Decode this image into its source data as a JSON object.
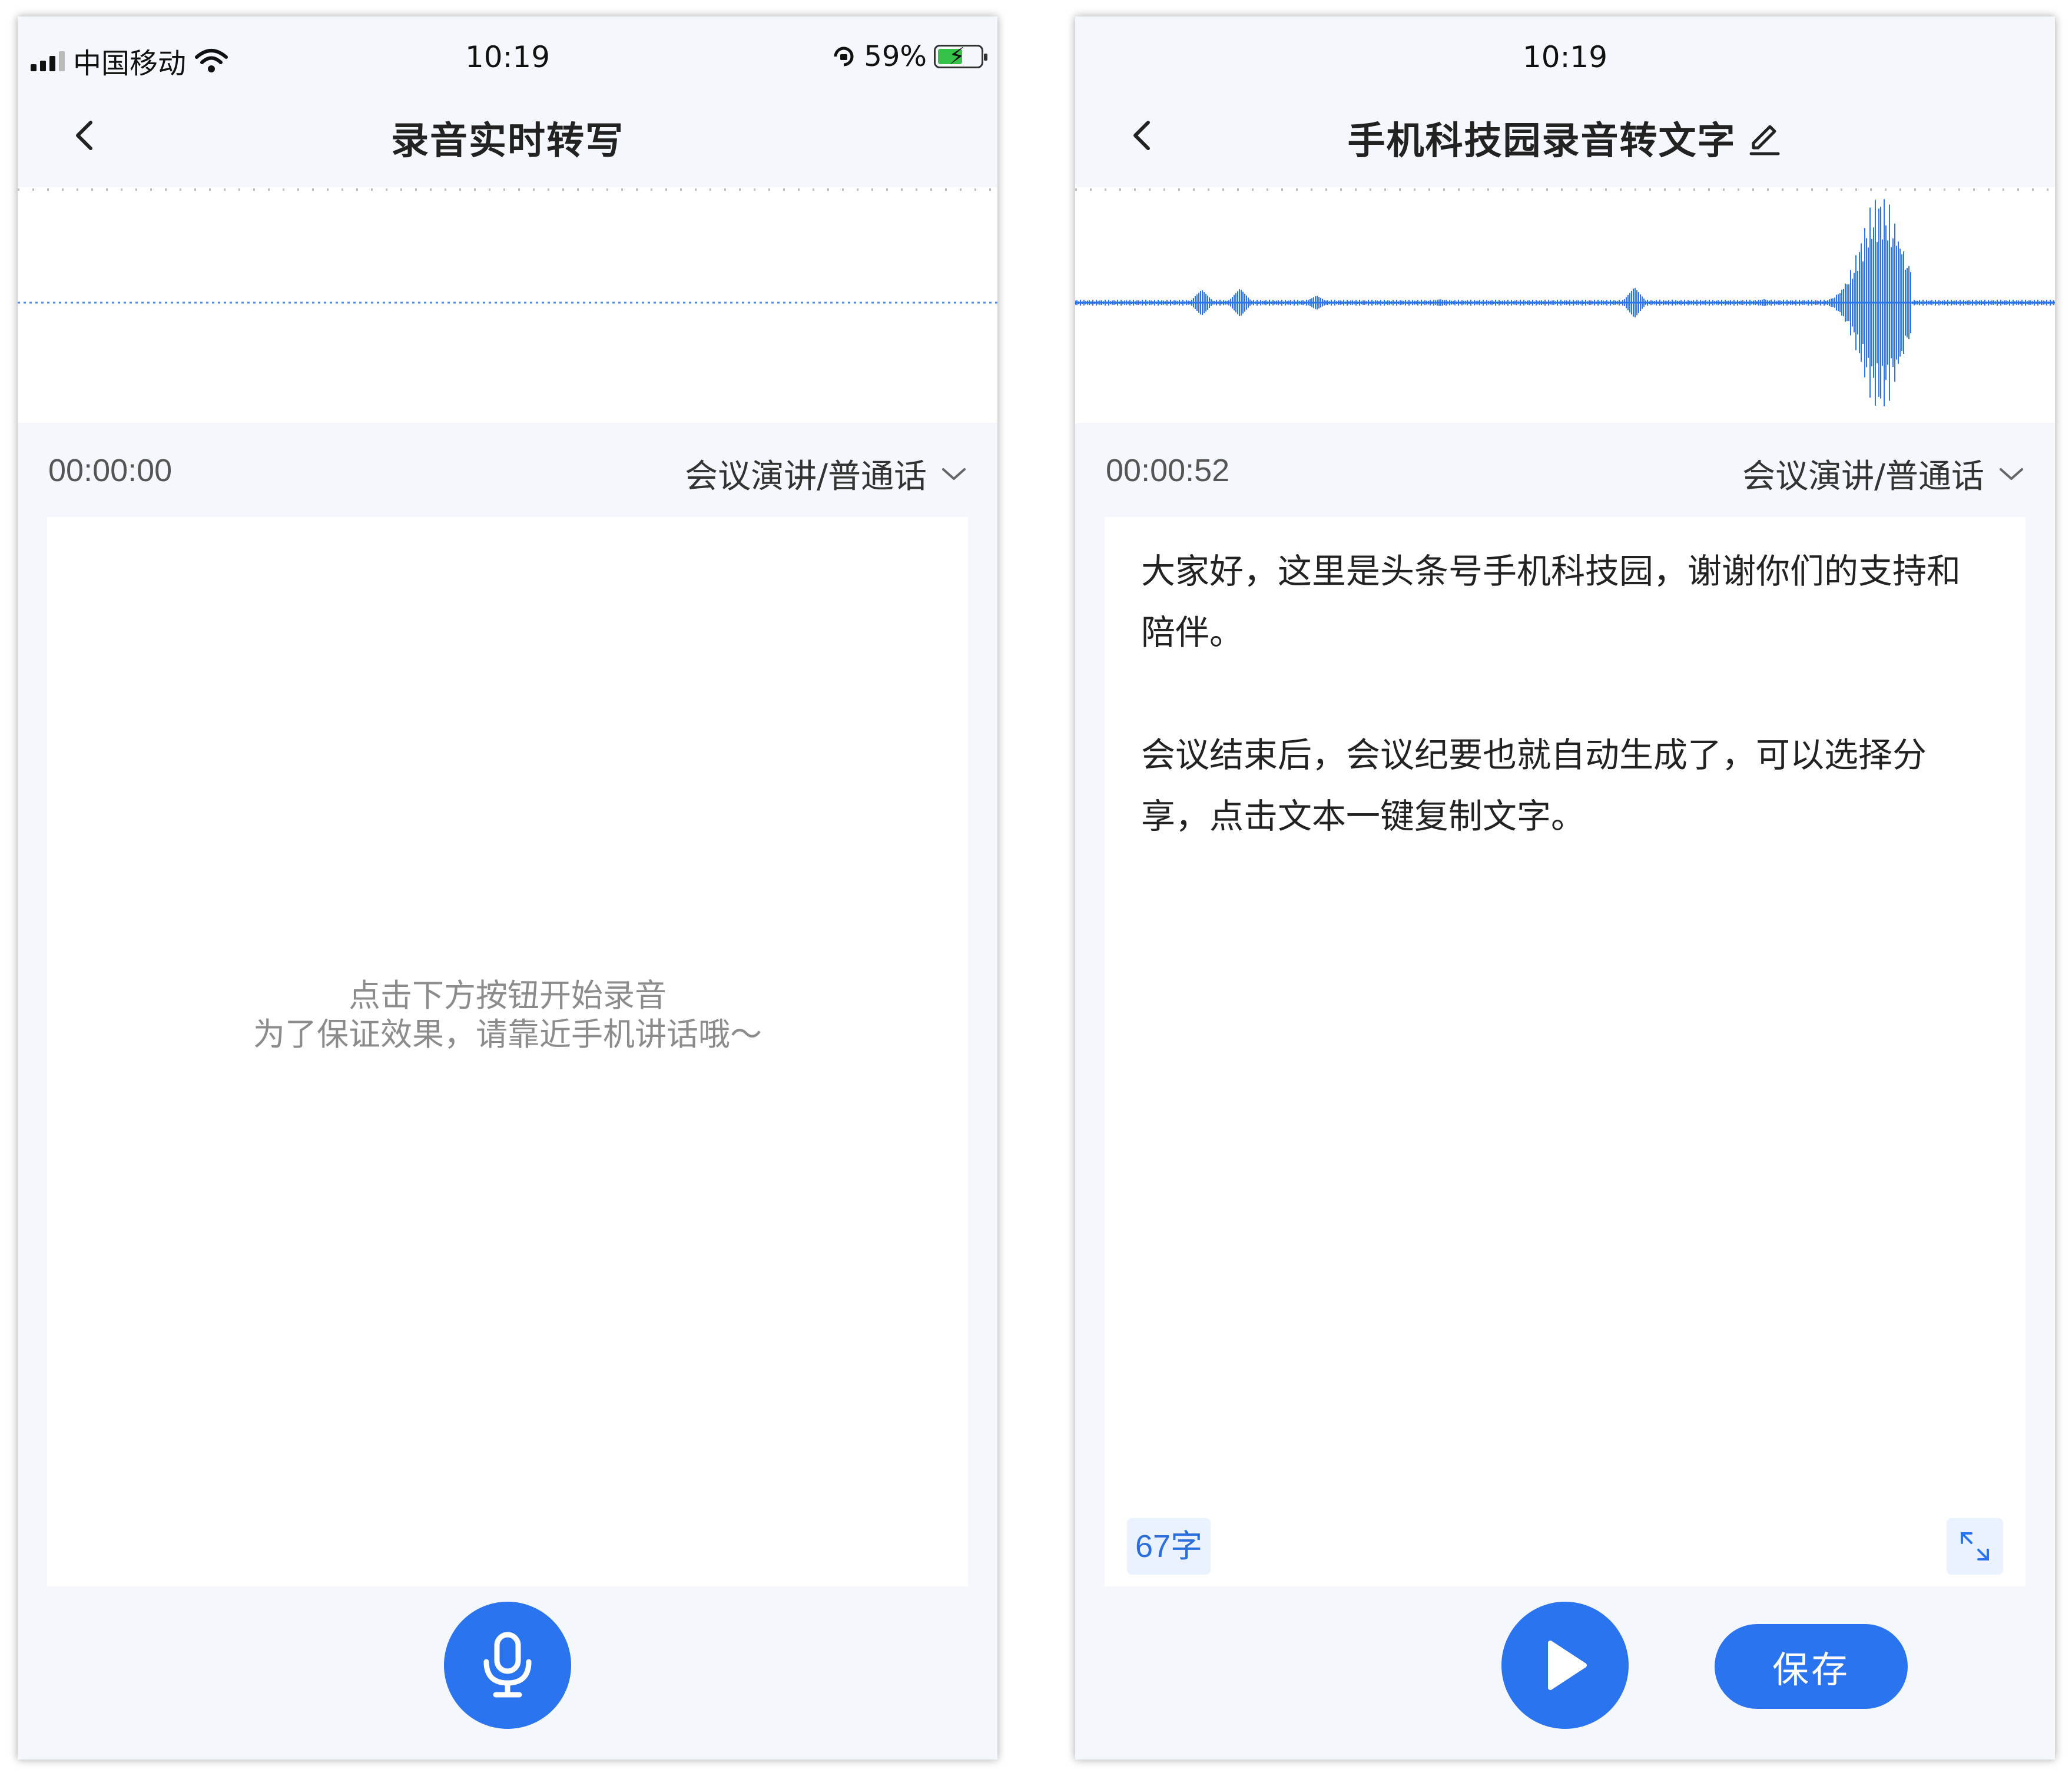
{
  "status_bar": {
    "carrier": "中国移动",
    "time": "10:19",
    "battery_percent": "59%",
    "battery_level": 0.59
  },
  "screen_left": {
    "title": "录音实时转写",
    "timer": "00:00:00",
    "mode": "会议演讲/普通话",
    "hint_line1": "点击下方按钮开始录音",
    "hint_line2": "为了保证效果，请靠近手机讲话哦～",
    "icons": [
      "back-icon",
      "chevron-down-icon",
      "mic-icon"
    ]
  },
  "screen_right": {
    "time": "10:19",
    "title": "手机科技园录音转文字",
    "timer": "00:00:52",
    "mode": "会议演讲/普通话",
    "paragraphs": [
      "大家好，这里是头条号手机科技园，谢谢你们的支持和陪伴。",
      "会议结束后，会议纪要也就自动生成了，可以选择分享，点击文本一键复制文字。"
    ],
    "char_count": "67字",
    "save_label": "保存",
    "icons": [
      "back-icon",
      "edit-icon",
      "chevron-down-icon",
      "expand-icon",
      "play-icon"
    ]
  },
  "colors": {
    "accent": "#2b74f0",
    "background": "#f4f7fc",
    "card": "#ffffff",
    "hint_text": "#8c8c8c"
  }
}
